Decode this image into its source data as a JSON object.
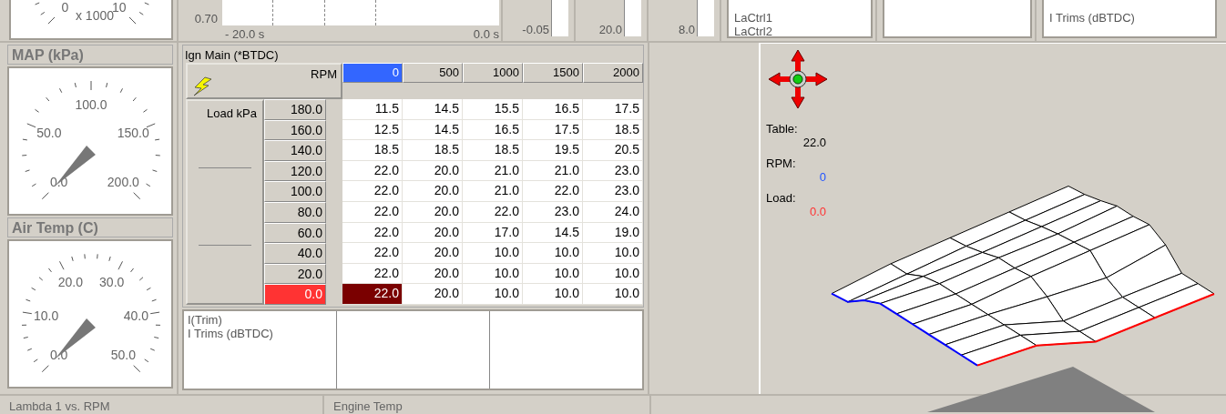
{
  "top_panels": {
    "rpm_gauge": {
      "labels": [
        "0",
        "10"
      ],
      "multiplier": "x 1000"
    },
    "trend_chart": {
      "y_label": "0.70",
      "x_start": "- 20.0 s",
      "x_end": "0.0 s"
    },
    "bars": [
      {
        "reading": "-0.05"
      },
      {
        "reading": "20.0"
      },
      {
        "reading": "8.0"
      }
    ],
    "channel_list": [
      "LaCtrl1",
      "LaCtrl2"
    ],
    "trim_list": [
      "I Trims (dBTDC)"
    ]
  },
  "gauges": [
    {
      "title": "MAP (kPa)",
      "labels": [
        "0.0",
        "50.0",
        "100.0",
        "150.0",
        "200.0"
      ]
    },
    {
      "title": "Air Temp (C)",
      "labels": [
        "0.0",
        "10.0",
        "20.0",
        "30.0",
        "40.0",
        "50.0"
      ]
    }
  ],
  "table": {
    "title": "Ign Main (*BTDC)",
    "x_axis": "RPM",
    "y_axis": "Load kPa",
    "columns": [
      {
        "label": "0",
        "selected": true
      },
      {
        "label": "500",
        "selected": false
      },
      {
        "label": "1000",
        "selected": false
      },
      {
        "label": "1500",
        "selected": false
      },
      {
        "label": "2000",
        "selected": false
      }
    ],
    "rows": [
      {
        "label": "180.0",
        "selected": false,
        "cells": [
          {
            "value": "11.5",
            "selected": false
          },
          {
            "value": "14.5",
            "selected": false
          },
          {
            "value": "15.5",
            "selected": false
          },
          {
            "value": "16.5",
            "selected": false
          },
          {
            "value": "17.5",
            "selected": false
          }
        ]
      },
      {
        "label": "160.0",
        "selected": false,
        "cells": [
          {
            "value": "12.5",
            "selected": false
          },
          {
            "value": "14.5",
            "selected": false
          },
          {
            "value": "16.5",
            "selected": false
          },
          {
            "value": "17.5",
            "selected": false
          },
          {
            "value": "18.5",
            "selected": false
          }
        ]
      },
      {
        "label": "140.0",
        "selected": false,
        "cells": [
          {
            "value": "18.5",
            "selected": false
          },
          {
            "value": "18.5",
            "selected": false
          },
          {
            "value": "18.5",
            "selected": false
          },
          {
            "value": "19.5",
            "selected": false
          },
          {
            "value": "20.5",
            "selected": false
          }
        ]
      },
      {
        "label": "120.0",
        "selected": false,
        "cells": [
          {
            "value": "22.0",
            "selected": false
          },
          {
            "value": "20.0",
            "selected": false
          },
          {
            "value": "21.0",
            "selected": false
          },
          {
            "value": "21.0",
            "selected": false
          },
          {
            "value": "23.0",
            "selected": false
          }
        ]
      },
      {
        "label": "100.0",
        "selected": false,
        "cells": [
          {
            "value": "22.0",
            "selected": false
          },
          {
            "value": "20.0",
            "selected": false
          },
          {
            "value": "21.0",
            "selected": false
          },
          {
            "value": "22.0",
            "selected": false
          },
          {
            "value": "23.0",
            "selected": false
          }
        ]
      },
      {
        "label": "80.0",
        "selected": false,
        "cells": [
          {
            "value": "22.0",
            "selected": false
          },
          {
            "value": "20.0",
            "selected": false
          },
          {
            "value": "22.0",
            "selected": false
          },
          {
            "value": "23.0",
            "selected": false
          },
          {
            "value": "24.0",
            "selected": false
          }
        ]
      },
      {
        "label": "60.0",
        "selected": false,
        "cells": [
          {
            "value": "22.0",
            "selected": false
          },
          {
            "value": "20.0",
            "selected": false
          },
          {
            "value": "17.0",
            "selected": false
          },
          {
            "value": "14.5",
            "selected": false
          },
          {
            "value": "19.0",
            "selected": false
          }
        ]
      },
      {
        "label": "40.0",
        "selected": false,
        "cells": [
          {
            "value": "22.0",
            "selected": false
          },
          {
            "value": "20.0",
            "selected": false
          },
          {
            "value": "10.0",
            "selected": false
          },
          {
            "value": "10.0",
            "selected": false
          },
          {
            "value": "10.0",
            "selected": false
          }
        ]
      },
      {
        "label": "20.0",
        "selected": false,
        "cells": [
          {
            "value": "22.0",
            "selected": false
          },
          {
            "value": "20.0",
            "selected": false
          },
          {
            "value": "10.0",
            "selected": false
          },
          {
            "value": "10.0",
            "selected": false
          },
          {
            "value": "10.0",
            "selected": false
          }
        ]
      },
      {
        "label": "0.0",
        "selected": true,
        "cells": [
          {
            "value": "22.0",
            "selected": true
          },
          {
            "value": "20.0",
            "selected": false
          },
          {
            "value": "10.0",
            "selected": false
          },
          {
            "value": "10.0",
            "selected": false
          },
          {
            "value": "10.0",
            "selected": false
          }
        ]
      }
    ]
  },
  "trims": {
    "lines": [
      "I(Trim)",
      "I Trims (dBTDC)"
    ]
  },
  "view3d": {
    "table_label": "Table:",
    "table_value": "22.0",
    "rpm_label": "RPM:",
    "rpm_value": "0",
    "load_label": "Load:",
    "load_value": "0.0"
  },
  "bottom_panels": [
    "Lambda 1 vs. RPM",
    "Engine Temp"
  ]
}
